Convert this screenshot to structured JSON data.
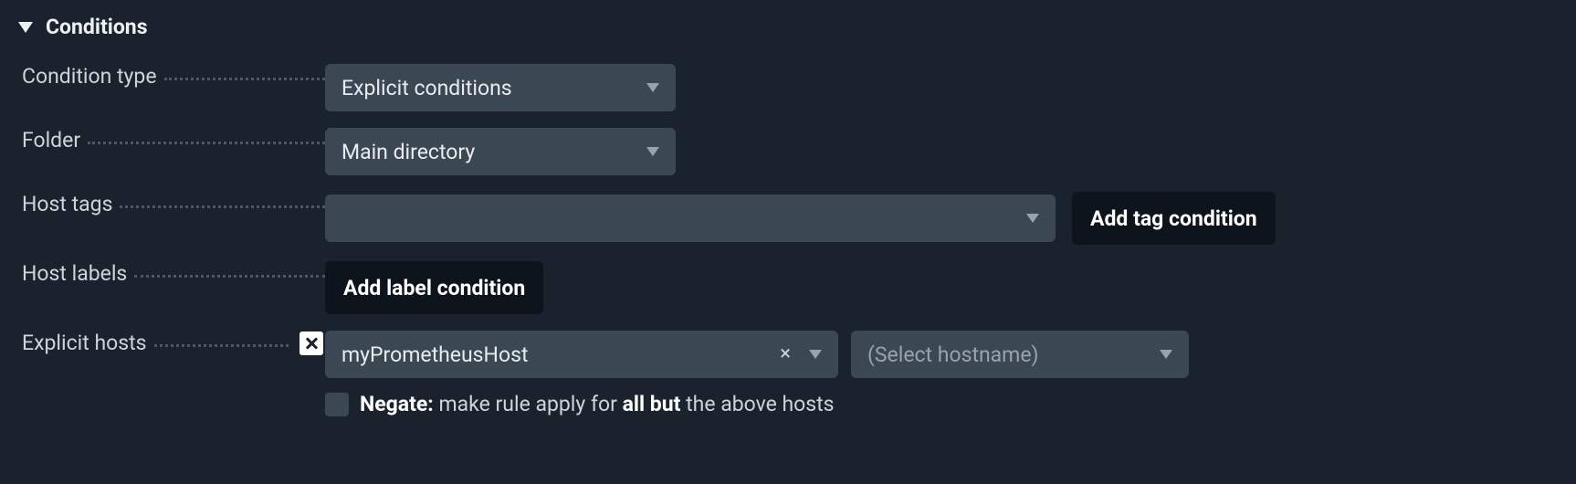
{
  "section": {
    "title": "Conditions"
  },
  "labels": {
    "condition_type": "Condition type",
    "folder": "Folder",
    "host_tags": "Host tags",
    "host_labels": "Host labels",
    "explicit_hosts": "Explicit hosts"
  },
  "condition_type_select": {
    "value": "Explicit conditions"
  },
  "folder_select": {
    "value": "Main directory"
  },
  "host_tags_select": {
    "value": ""
  },
  "buttons": {
    "add_tag": "Add tag condition",
    "add_label": "Add label condition"
  },
  "explicit_hosts": {
    "chosen": "myPrometheusHost",
    "placeholder": "(Select hostname)"
  },
  "negate": {
    "prefix": "Negate:",
    "mid1": " make rule apply for ",
    "bold": "all but",
    "mid2": " the above hosts",
    "checked": false
  }
}
